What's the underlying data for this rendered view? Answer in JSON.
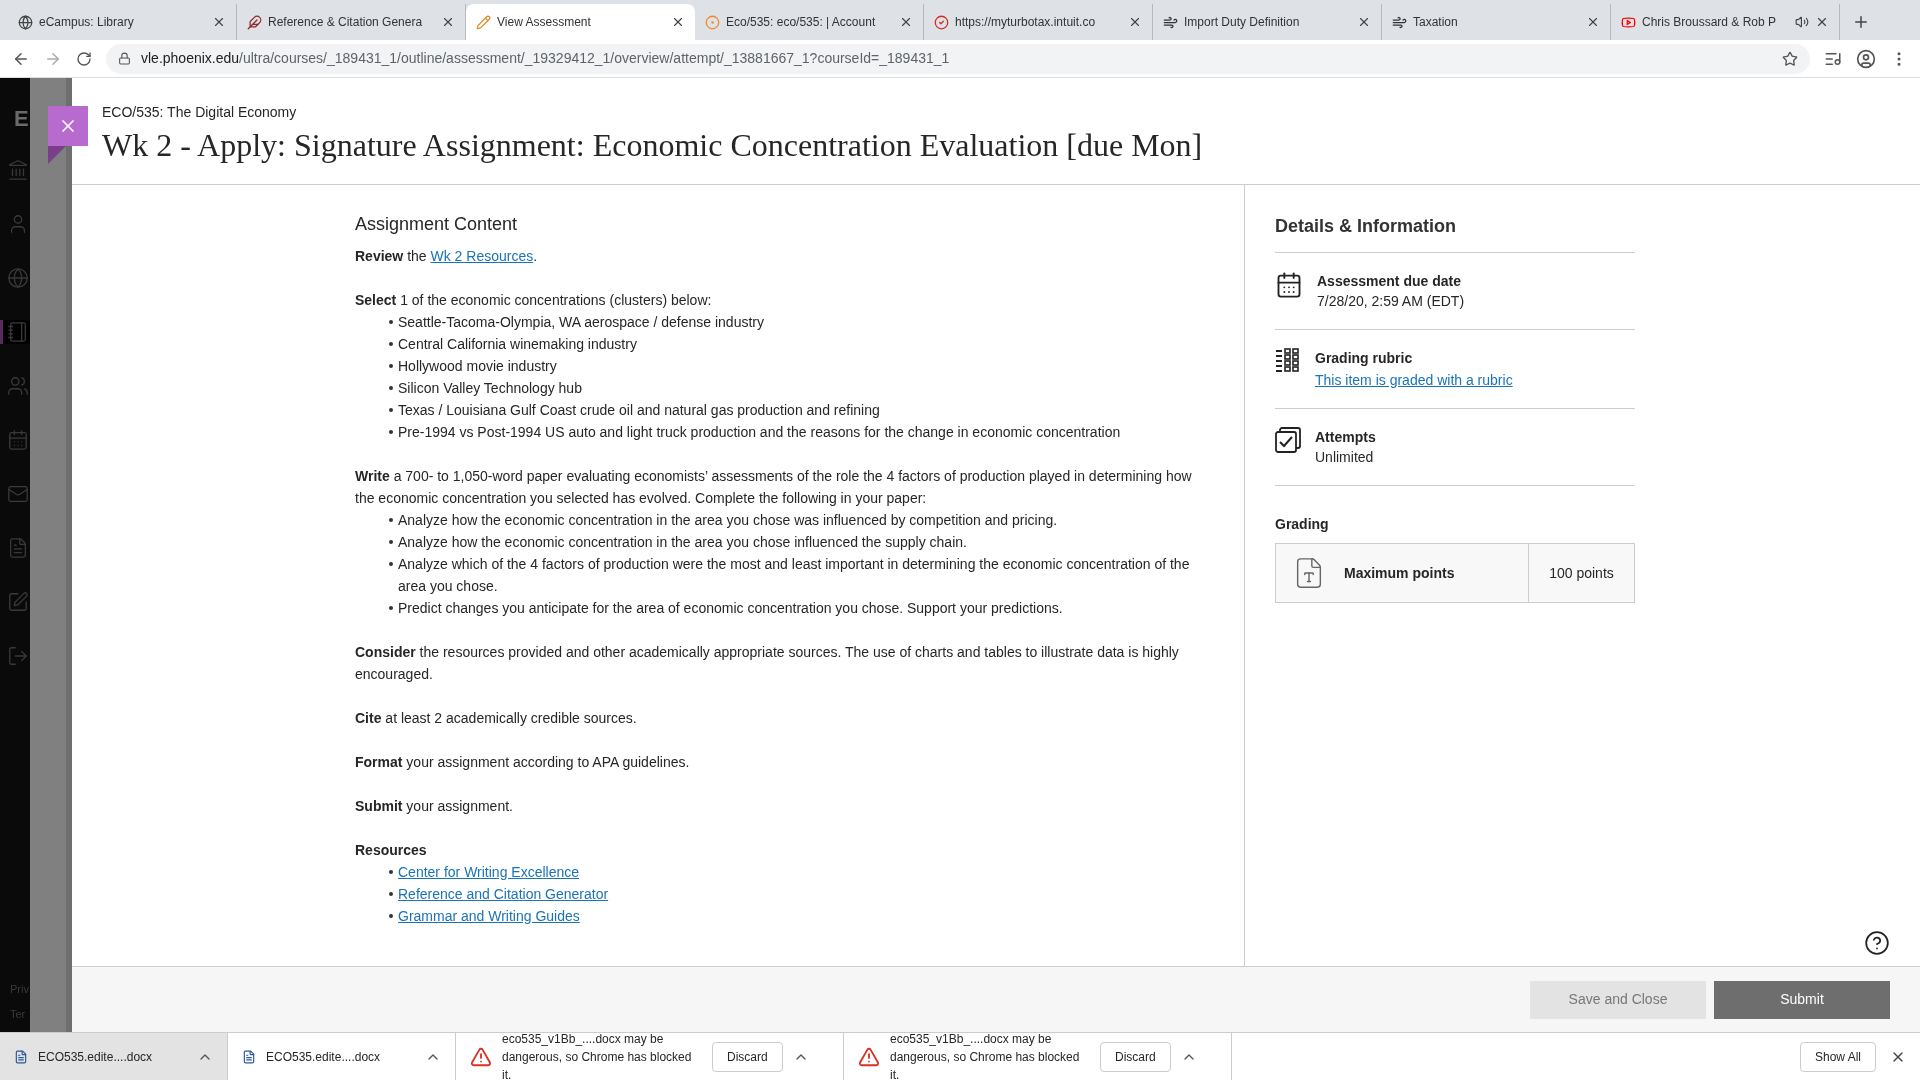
{
  "browser": {
    "tabs": [
      {
        "title": "eCampus: Library",
        "selected": false,
        "audio": false
      },
      {
        "title": "Reference & Citation Genera",
        "selected": false,
        "audio": false
      },
      {
        "title": "View Assessment",
        "selected": true,
        "audio": false
      },
      {
        "title": "Eco/535: eco/535: | Account",
        "selected": false,
        "audio": false
      },
      {
        "title": "https://myturbotax.intuit.co",
        "selected": false,
        "audio": false
      },
      {
        "title": "Import Duty Definition",
        "selected": false,
        "audio": false
      },
      {
        "title": "Taxation",
        "selected": false,
        "audio": false
      },
      {
        "title": "Chris Broussard & Rob P",
        "selected": false,
        "audio": true
      }
    ],
    "url_domain": "vle.phoenix.edu",
    "url_path": "/ultra/courses/_189431_1/outline/assessment/_19329412_1/overview/attempt/_13881667_1?courseId=_189431_1"
  },
  "sidebar": {
    "logo": "E",
    "items": [
      {
        "selected": false
      },
      {
        "selected": false
      },
      {
        "selected": false
      },
      {
        "selected": true
      },
      {
        "selected": false
      },
      {
        "selected": false
      },
      {
        "selected": false
      },
      {
        "selected": false
      },
      {
        "selected": false
      },
      {
        "selected": false
      }
    ],
    "footer": [
      "Priv",
      "Ter"
    ]
  },
  "header": {
    "course": "ECO/535: The Digital Economy",
    "title": "Wk 2 - Apply: Signature Assignment: Economic Concentration Evaluation [due Mon]"
  },
  "content": {
    "heading": "Assignment Content",
    "sections": [
      {
        "kind": "paragraph",
        "text": "**Review** the ",
        "link": "Wk 2 Resources",
        "tail": "."
      },
      {
        "kind": "paragraph",
        "text": "**Select** 1 of the economic concentrations (clusters) below:",
        "bullets": [
          "Seattle-Tacoma-Olympia, WA aerospace / defense industry",
          "Central California winemaking industry",
          "Hollywood movie industry",
          "Silicon Valley Technology hub",
          "Texas / Louisiana Gulf Coast crude oil and natural gas production and refining",
          "Pre-1994 vs Post-1994 US auto and light truck production and the reasons for the change in economic concentration"
        ]
      },
      {
        "kind": "paragraph",
        "text": "**Write** a 700- to 1,050-word paper evaluating economists’ assessments of the role the 4 factors of production played in determining how the economic concentration you selected has evolved. Complete the following in your paper:",
        "bullets": [
          "Analyze how the economic concentration in the area you chose was influenced by competition and pricing.",
          "Analyze how the economic concentration in the area you chose influenced the supply chain.",
          "Analyze which of the 4 factors of production were the most and least important in determining the economic concentration of the area you chose.",
          "Predict changes you anticipate for the area of economic concentration you chose. Support your predictions."
        ]
      },
      {
        "kind": "paragraph",
        "text": "**Consider** the resources provided and other academically appropriate sources. The use of charts and tables to illustrate data is highly encouraged."
      },
      {
        "kind": "paragraph",
        "text": "**Cite** at least 2 academically credible sources."
      },
      {
        "kind": "paragraph",
        "text": "**Format** your assignment according to APA guidelines."
      },
      {
        "kind": "paragraph",
        "text": "**Submit** your assignment."
      },
      {
        "kind": "heading",
        "text": "Resources",
        "links": [
          "Center for Writing Excellence",
          "Reference and Citation Generator",
          "Grammar and Writing Guides"
        ]
      }
    ]
  },
  "details": {
    "heading": "Details & Information",
    "items": [
      {
        "label": "Assessment due date",
        "value": "7/28/20, 2:59 AM (EDT)"
      },
      {
        "label": "Grading rubric",
        "link": "This item is graded with a rubric"
      },
      {
        "label": "Attempts",
        "value": "Unlimited"
      }
    ],
    "grading": {
      "heading": "Grading",
      "label": "Maximum points",
      "value": "100 points"
    }
  },
  "actions": {
    "secondary": "Save and Close",
    "primary": "Submit"
  },
  "downloads": {
    "items": [
      {
        "kind": "file",
        "name": "ECO535.edite....docx",
        "selected": true
      },
      {
        "kind": "file",
        "name": "ECO535.edite....docx",
        "selected": false
      },
      {
        "kind": "blocked",
        "name": "eco535_v1Bb_....docx may be dangerous, so Chrome has blocked it.",
        "action": "Discard",
        "selected": false
      },
      {
        "kind": "blocked",
        "name": "eco535_v1Bb_....docx may be dangerous, so Chrome has blocked it.",
        "action": "Discard",
        "selected": false
      }
    ],
    "show_all": "Show All"
  }
}
